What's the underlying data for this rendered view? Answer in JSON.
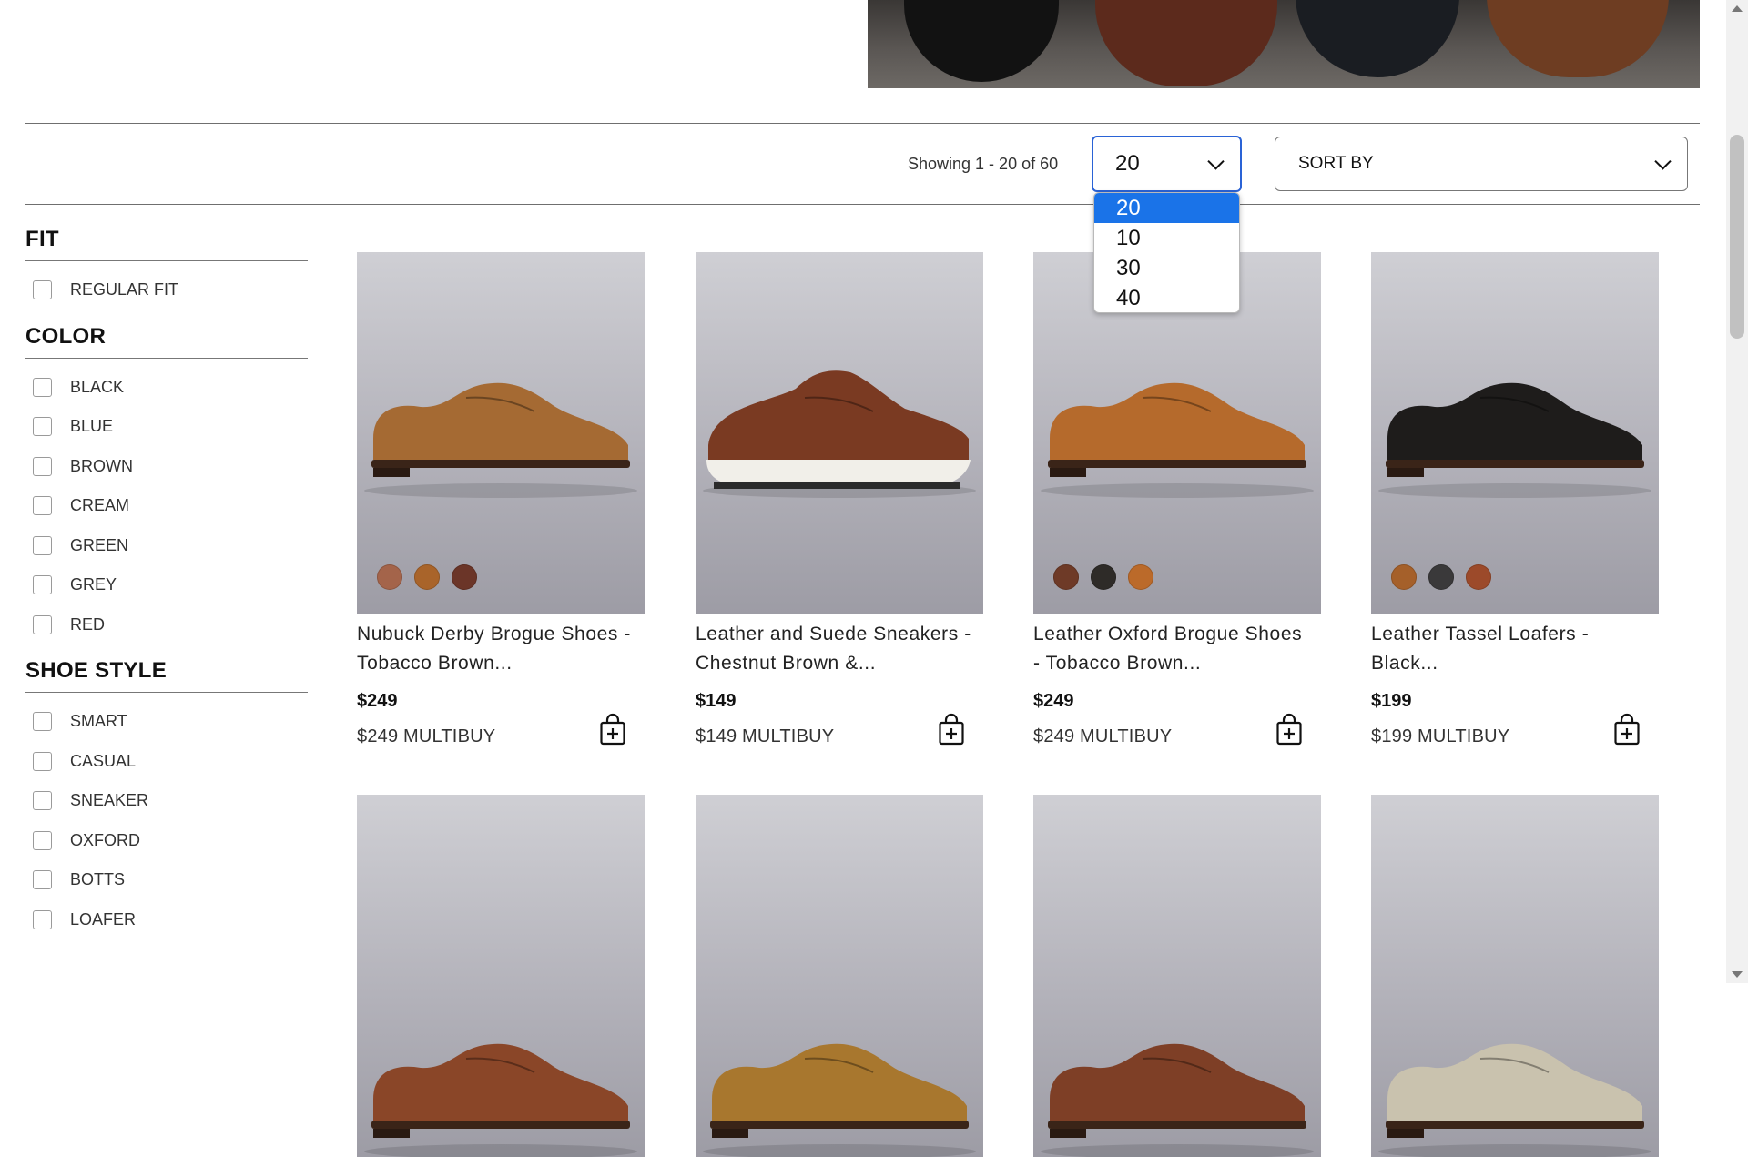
{
  "toolbar": {
    "showing_text": "Showing 1 - 20 of 60",
    "per_page_value": "20",
    "per_page_options": [
      "20",
      "10",
      "30",
      "40"
    ],
    "sort_label": "SORT BY"
  },
  "filters": [
    {
      "title": "FIT",
      "items": [
        "REGULAR FIT"
      ]
    },
    {
      "title": "COLOR",
      "items": [
        "BLACK",
        "BLUE",
        "BROWN",
        "CREAM",
        "GREEN",
        "GREY",
        "RED"
      ]
    },
    {
      "title": "SHOE STYLE",
      "items": [
        "SMART",
        "CASUAL",
        "SNEAKER",
        "OXFORD",
        "BOTTS",
        "LOAFER"
      ]
    }
  ],
  "products": [
    {
      "title_line1": "Nubuck Derby Brogue Shoes -",
      "title_line2": "Tobacco Brown...",
      "price": "$249",
      "multibuy": "$249 MULTIBUY",
      "swatches": [
        "#a4644a",
        "#a9642a",
        "#6b3528"
      ],
      "shoe_color": "#a56a33"
    },
    {
      "title_line1": "Leather and Suede Sneakers -",
      "title_line2": "Chestnut Brown &...",
      "price": "$149",
      "multibuy": "$149 MULTIBUY",
      "swatches": [],
      "shoe_color": "#7a3a22"
    },
    {
      "title_line1": "Leather Oxford Brogue Shoes",
      "title_line2": "- Tobacco Brown...",
      "price": "$249",
      "multibuy": "$249 MULTIBUY",
      "swatches": [
        "#6e3a27",
        "#2e2b28",
        "#bb6a2a"
      ],
      "shoe_color": "#b56a2c"
    },
    {
      "title_line1": "Leather Tassel Loafers -",
      "title_line2": "Black...",
      "price": "$199",
      "multibuy": "$199 MULTIBUY",
      "swatches": [
        "#a5602a",
        "#3a393a",
        "#9c4a2a"
      ],
      "shoe_color": "#1e1c1b"
    },
    {
      "title_line1": "",
      "title_line2": "",
      "price": "",
      "multibuy": "",
      "swatches": [],
      "shoe_color": "#8a4628"
    },
    {
      "title_line1": "",
      "title_line2": "",
      "price": "",
      "multibuy": "",
      "swatches": [],
      "shoe_color": "#a8772e"
    },
    {
      "title_line1": "",
      "title_line2": "",
      "price": "",
      "multibuy": "",
      "swatches": [],
      "shoe_color": "#7e3f26"
    },
    {
      "title_line1": "",
      "title_line2": "",
      "price": "",
      "multibuy": "",
      "swatches": [],
      "shoe_color": "#c9c2ae"
    }
  ],
  "colors": {
    "accent": "#2a63d6",
    "selected_option": "#1a73e8"
  },
  "icons": {
    "add_to_bag": "shopping-bag-plus-icon",
    "dropdown": "chevron-down-icon"
  }
}
